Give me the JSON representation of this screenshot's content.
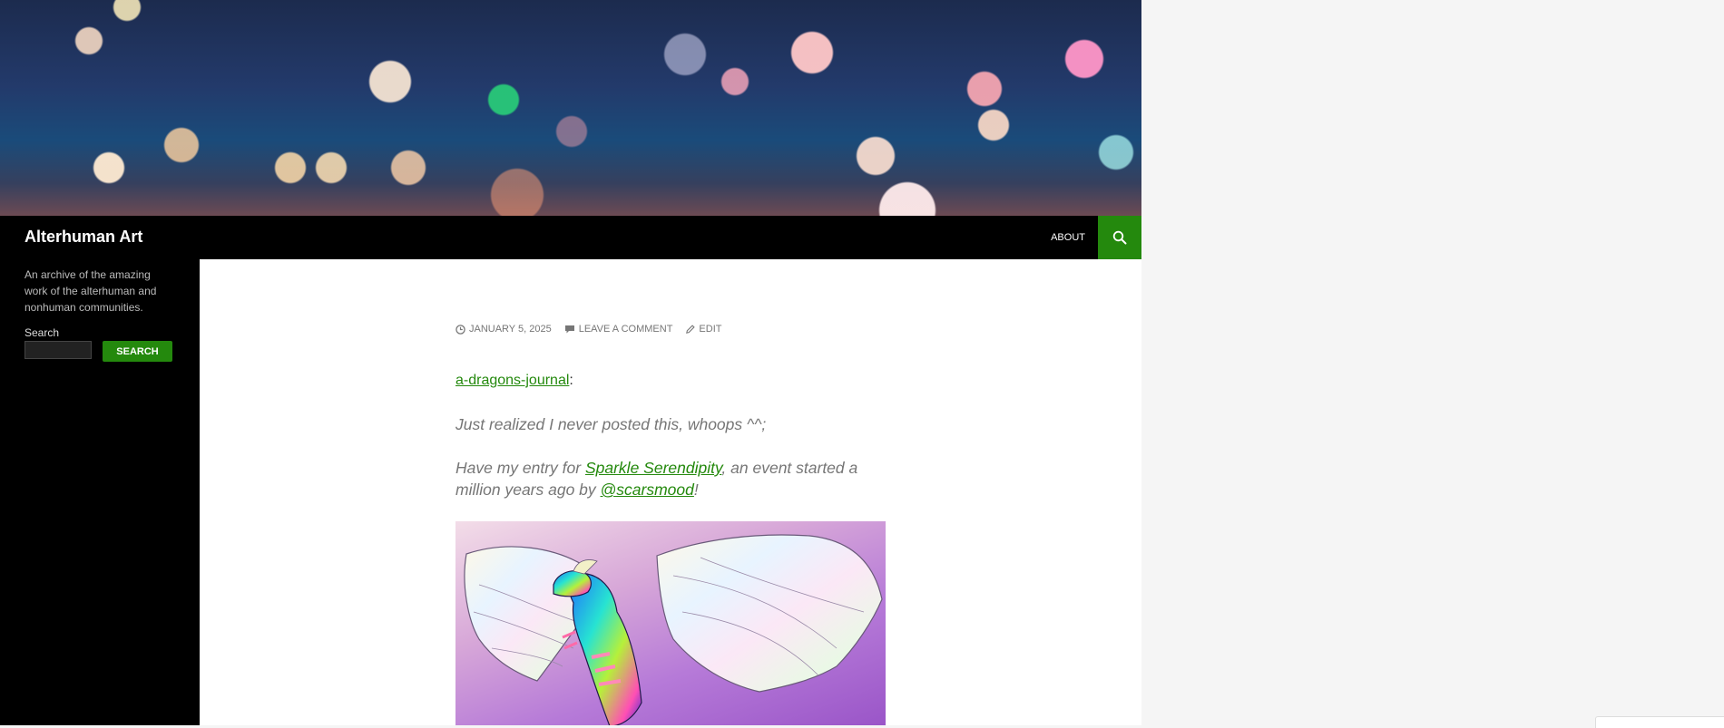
{
  "site": {
    "title": "Alterhuman Art",
    "description": "An archive of the amazing work of the alterhuman and nonhuman communities."
  },
  "nav": {
    "about_label": "About"
  },
  "sidebar": {
    "search_label": "Search",
    "search_value": "",
    "search_button": "Search"
  },
  "post": {
    "date": "January 5, 2025",
    "comment_link": "Leave a comment",
    "edit_link": "Edit",
    "source_link": "a-dragons-journal",
    "source_suffix": ":",
    "quote1": "Just realized I never posted this, whoops ^^;",
    "quote2_before": "Have my entry for ",
    "quote2_link": "Sparkle Serendipity",
    "quote2_middle": ", an event started a million years ago by ",
    "quote2_handle": "@scarsmood",
    "quote2_end": "!"
  },
  "colors": {
    "accent": "#24890d",
    "masthead": "#000000",
    "page_bg": "#f5f5f5"
  }
}
